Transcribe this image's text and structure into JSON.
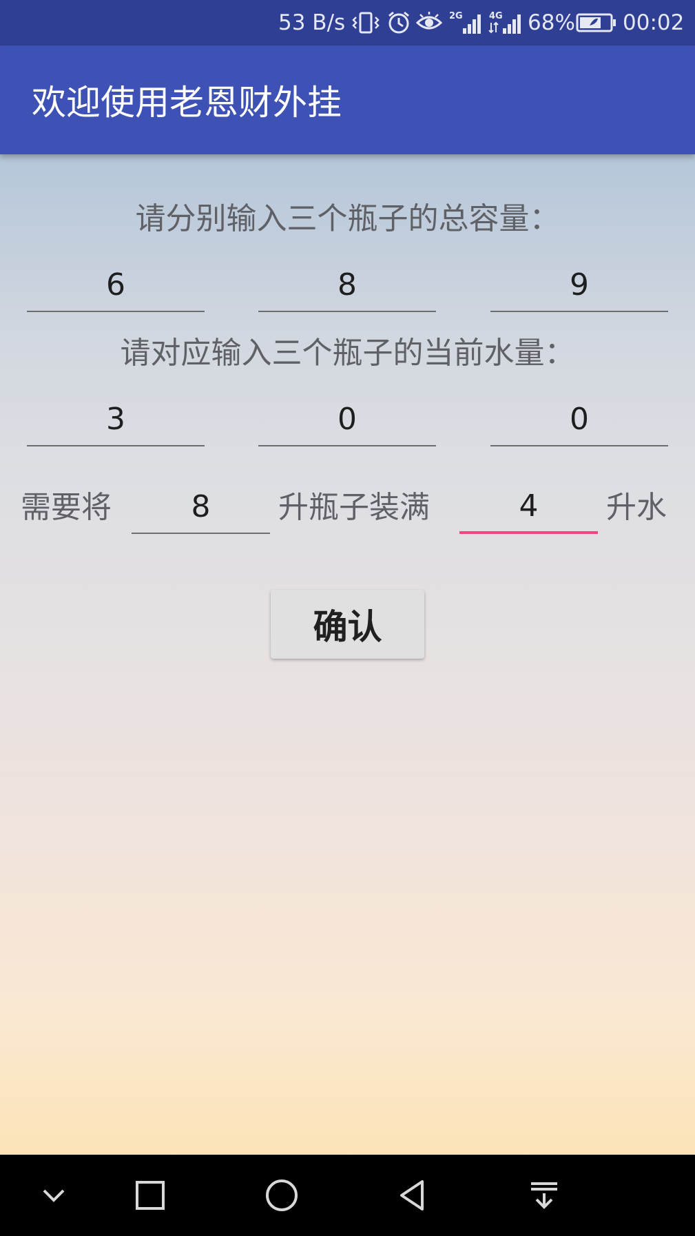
{
  "status_bar": {
    "speed": "53 B/s",
    "net1": "2G",
    "net2": "4G",
    "battery": "68%",
    "time": "00:02",
    "icons": [
      "vibrate-icon",
      "alarm-icon",
      "eye-icon",
      "signal-icon",
      "signal-icon",
      "battery-icon"
    ]
  },
  "app_bar": {
    "title": "欢迎使用老恩财外挂"
  },
  "capacity": {
    "prompt": "请分别输入三个瓶子的总容量：",
    "values": [
      "6",
      "8",
      "9"
    ]
  },
  "current": {
    "prompt": "请对应输入三个瓶子的当前水量：",
    "values": [
      "3",
      "0",
      "0"
    ]
  },
  "target": {
    "label_before": "需要将",
    "bottle": "8",
    "label_middle": "升瓶子装满",
    "amount": "4",
    "label_after": "升水"
  },
  "confirm_label": "确认",
  "nav_bar": {
    "icons": [
      "chevron-down-icon",
      "recent-apps-icon",
      "home-icon",
      "back-icon",
      "pull-down-icon"
    ]
  },
  "colors": {
    "status_bar": "#2f3f94",
    "app_bar": "#3e52b5",
    "focus_accent": "#ee4786"
  }
}
